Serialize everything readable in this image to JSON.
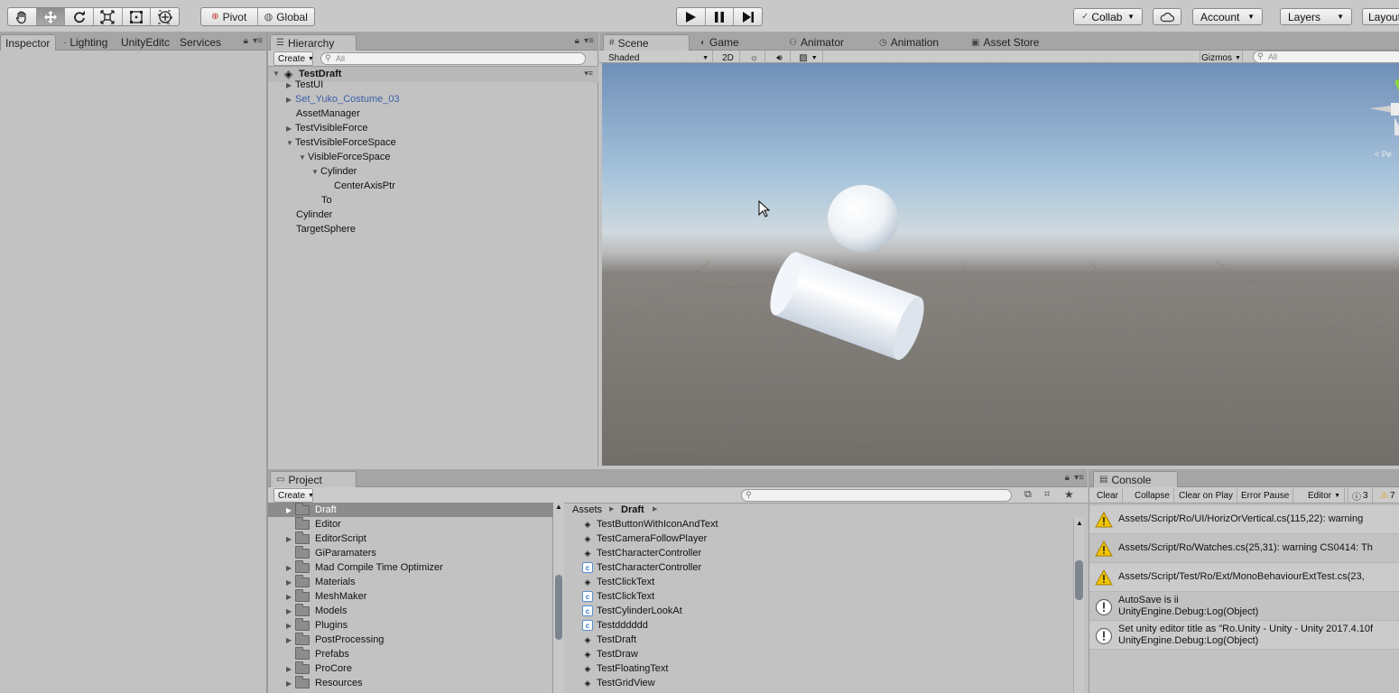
{
  "toolbar": {
    "pivot_label": "Pivot",
    "global_label": "Global",
    "collab_label": "Collab",
    "account_label": "Account",
    "layers_label": "Layers",
    "layout_label": "Layout"
  },
  "inspector": {
    "tabs": [
      "Inspector",
      "Lighting",
      "UnityEditc",
      "Services"
    ]
  },
  "hierarchy": {
    "tab": "Hierarchy",
    "create_label": "Create",
    "search_placeholder": "All",
    "scene_name": "TestDraft",
    "items": [
      "TestUI",
      "Set_Yuko_Costume_03",
      "AssetManager",
      "TestVisibleForce",
      "TestVisibleForceSpace",
      "VisibleForceSpace",
      "Cylinder",
      "CenterAxisPtr",
      "To",
      "Cylinder",
      "TargetSphere"
    ]
  },
  "scene": {
    "tabs": [
      "Scene",
      "Game",
      "Animator",
      "Animation",
      "Asset Store"
    ],
    "shading_mode": "Shaded",
    "mode_2d": "2D",
    "gizmos_label": "Gizmos",
    "search_placeholder": "All"
  },
  "project": {
    "tab": "Project",
    "create_label": "Create",
    "folders": [
      "Draft",
      "Editor",
      "EditorScript",
      "GiParamaters",
      "Mad Compile Time Optimizer",
      "Materials",
      "MeshMaker",
      "Models",
      "Plugins",
      "PostProcessing",
      "Prefabs",
      "ProCore",
      "Resources"
    ],
    "breadcrumb": [
      "Assets",
      "Draft"
    ],
    "assets": [
      "TestButtonWithIconAndText",
      "TestCameraFollowPlayer",
      "TestCharacterController",
      "TestCharacterController",
      "TestClickText",
      "TestClickText",
      "TestCylinderLookAt",
      "Testdddddd",
      "TestDraft",
      "TestDraw",
      "TestFloatingText",
      "TestGridView"
    ]
  },
  "console": {
    "tab": "Console",
    "buttons": [
      "Clear",
      "Collapse",
      "Clear on Play",
      "Error Pause",
      "Editor"
    ],
    "info_count": "3",
    "warn_count": "7",
    "logs": [
      {
        "type": "warning",
        "line1": "Assets/Script/Ro/UI/HorizOrVertical.cs(115,22): warning",
        "line2": ""
      },
      {
        "type": "warning",
        "line1": "Assets/Script/Ro/Watches.cs(25,31): warning CS0414: Th",
        "line2": ""
      },
      {
        "type": "warning",
        "line1": "Assets/Script/Test/Ro/Ext/MonoBehaviourExtTest.cs(23,",
        "line2": ""
      },
      {
        "type": "info",
        "line1": "AutoSave is ii",
        "line2": "UnityEngine.Debug:Log(Object)"
      },
      {
        "type": "info",
        "line1": "Set unity editor title as \"Ro.Unity - Unity - Unity 2017.4.10f",
        "line2": "UnityEngine.Debug:Log(Object)"
      }
    ]
  }
}
